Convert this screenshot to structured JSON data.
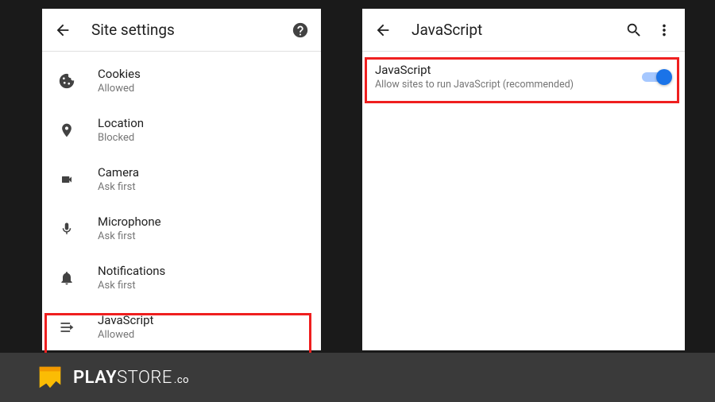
{
  "left": {
    "title": "Site settings",
    "items": [
      {
        "label": "Cookies",
        "status": "Allowed"
      },
      {
        "label": "Location",
        "status": "Blocked"
      },
      {
        "label": "Camera",
        "status": "Ask first"
      },
      {
        "label": "Microphone",
        "status": "Ask first"
      },
      {
        "label": "Notifications",
        "status": "Ask first"
      },
      {
        "label": "JavaScript",
        "status": "Allowed"
      }
    ]
  },
  "right": {
    "title": "JavaScript",
    "setting": {
      "label": "JavaScript",
      "description": "Allow sites to run JavaScript (recommended)",
      "enabled": true
    }
  },
  "footer": {
    "brand_a": "PLAY",
    "brand_b": "STORE",
    "suffix": ".co"
  }
}
